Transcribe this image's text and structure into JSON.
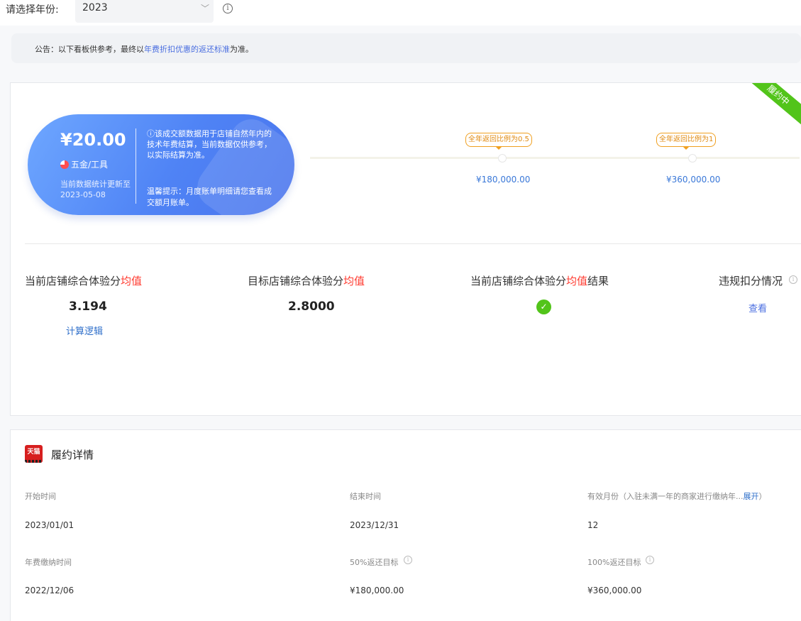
{
  "year_select": {
    "label": "请选择年份:",
    "value": "2023"
  },
  "notice": {
    "prefix": "公告：以下看板供参考，最终以",
    "link": "年费折扣优惠的返还标准",
    "suffix": "为准。"
  },
  "ribbon": "履约中",
  "summary": {
    "amount": "¥20.00",
    "category": "五金/工具",
    "updated": "当前数据统计更新至2023-05-08",
    "description": "ⓘ该成交额数据用于店铺自然年内的技术年费结算，当前数据仅供参考，以实际结算为准。",
    "tip": "温馨提示：月度账单明细请您查看成交额月账单。"
  },
  "targets": [
    {
      "badge": "全年返回比例为0.5",
      "amount": "¥180,000.00",
      "progress": 0
    },
    {
      "badge": "全年返回比例为1",
      "amount": "¥360,000.00",
      "progress": 0
    }
  ],
  "metrics": {
    "current_label_a": "当前店铺综合体验分",
    "current_label_b": "均值",
    "current_value": "3.194",
    "logic_link": "计算逻辑",
    "target_label_a": "目标店铺综合体验分",
    "target_label_b": "均值",
    "target_value": "2.8000",
    "result_label_a": "当前店铺综合体验分",
    "result_label_b": "均值",
    "result_label_c": "结果",
    "violation_label": "违规扣分情况",
    "view_link": "查看"
  },
  "detail": {
    "title": "履约详情",
    "icon_text": "天猫",
    "start_label": "开始时间",
    "start_value": "2023/01/01",
    "end_label": "结束时间",
    "end_value": "2023/12/31",
    "months_label": "有效月份（入驻未满一年的商家进行缴纳年...",
    "months_link": "展开",
    "months_suffix": "）",
    "months_value": "12",
    "fee_label": "年费缴纳时间",
    "fee_value": "2022/12/06",
    "half_label": "50%返还目标",
    "half_value": "¥180,000.00",
    "full_label": "100%返还目标",
    "full_value": "¥360,000.00"
  },
  "colors": {
    "accent_blue": "#4a6ee0",
    "success_green": "#52c41a",
    "warning_orange": "#f0a020",
    "highlight_red": "#ff3b30"
  }
}
